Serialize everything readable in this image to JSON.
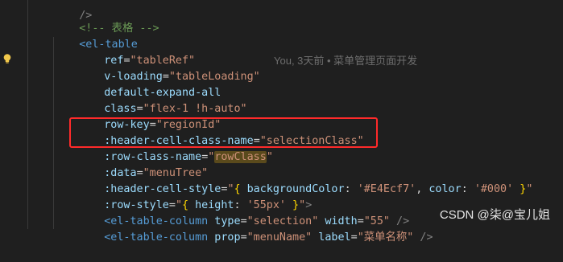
{
  "editor": {
    "lines": {
      "l0": {
        "fragment": "/>"
      },
      "l1": {
        "open": "<!--",
        "text": " 表格 ",
        "close": "-->"
      },
      "l2": {
        "tag": "<el-table"
      },
      "l3": {
        "attr": "ref",
        "eq": "=",
        "val": "\"tableRef\""
      },
      "l4": {
        "attr": "v-loading",
        "eq": "=",
        "val": "\"tableLoading\""
      },
      "l5": {
        "attr": "default-expand-all"
      },
      "l6": {
        "attr": "class",
        "eq": "=",
        "val": "\"flex-1 !h-auto\""
      },
      "l7": {
        "attr": "row-key",
        "eq": "=",
        "val": "\"regionId\""
      },
      "l8": {
        "attr": ":header-cell-class-name",
        "eq": "=",
        "val": "\"selectionClass\""
      },
      "l9": {
        "attr": ":row-class-name",
        "eq": "=",
        "q1": "\"",
        "val": "rowClass",
        "q2": "\""
      },
      "l10": {
        "attr": ":data",
        "eq": "=",
        "val": "\"menuTree\""
      },
      "l11": {
        "attr": ":header-cell-style",
        "eq": "=",
        "q1": "\"",
        "b1": "{",
        "k1": " backgroundColor",
        "c1": ": ",
        "v1": "'#E4Ecf7'",
        "sep": ", ",
        "k2": "color",
        "c2": ": ",
        "v2": "'#000'",
        "b2": " }",
        "q2": "\""
      },
      "l12": {
        "attr": ":row-style",
        "eq": "=",
        "q1": "\"",
        "b1": "{",
        "k1": " height",
        "c1": ": ",
        "v1": "'55px'",
        "b2": " }",
        "q2": "\"",
        "end": ">"
      },
      "l13": {
        "tag": "<el-table-column",
        "a1": " type",
        "eq1": "=",
        "v1": "\"selection\"",
        "a2": " width",
        "eq2": "=",
        "v2": "\"55\"",
        "end": " />"
      },
      "l14": {
        "tag": "<el-table-column",
        "a1": " prop",
        "eq1": "=",
        "v1": "\"menuName\"",
        "a2": " label",
        "eq2": "=",
        "v2": "\"菜单名称\"",
        "end": " />"
      }
    },
    "blame": "You, 3天前 • 菜单管理页面开发"
  },
  "watermark": "CSDN @柒@宝儿姐",
  "colors": {
    "background": "#1f1f1f",
    "tag": "#569cd6",
    "attribute": "#9cdcfe",
    "string": "#ce9178",
    "comment": "#6a9955",
    "highlight_box": "#ff2a2a"
  },
  "icons": {
    "gutter": "lightbulb-icon"
  }
}
